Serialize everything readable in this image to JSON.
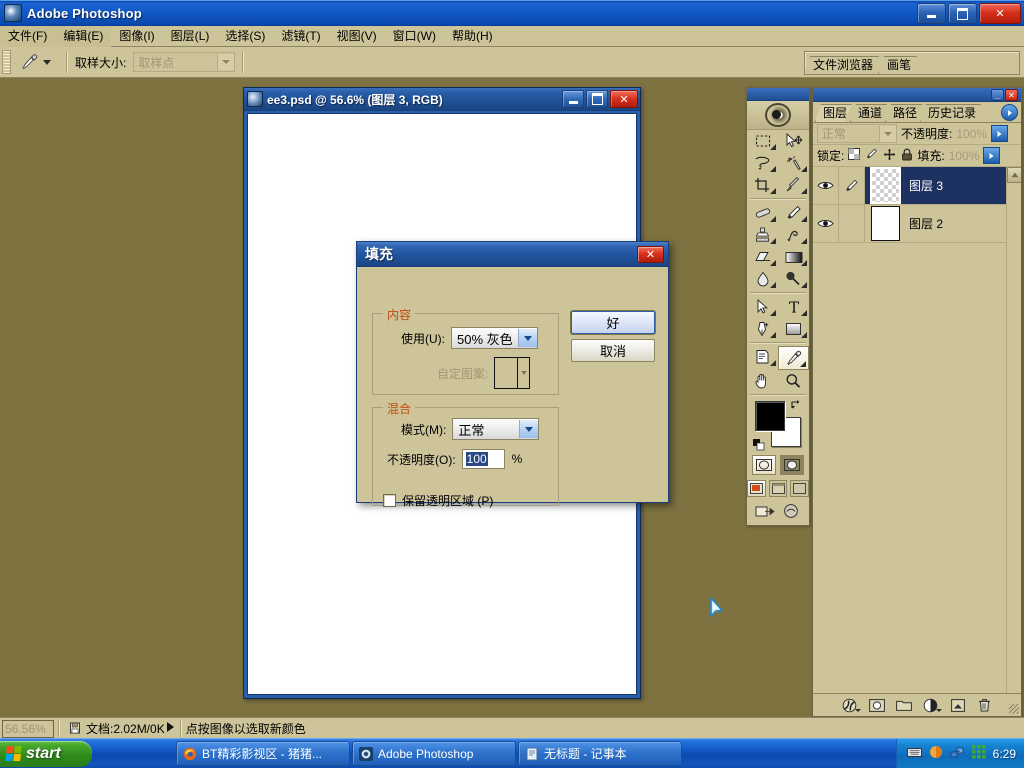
{
  "app": {
    "title": "Adobe Photoshop",
    "icon": "photoshop-icon",
    "window_buttons": {
      "minimize": "_",
      "maximize": "❐",
      "close": "✕"
    }
  },
  "menubar": {
    "items": [
      {
        "label": "文件(F)",
        "selected": true
      },
      {
        "label": "编辑(E)",
        "selected": true
      },
      {
        "label": "图像(I)",
        "selected": false
      },
      {
        "label": "图层(L)",
        "selected": false
      },
      {
        "label": "选择(S)",
        "selected": false
      },
      {
        "label": "滤镜(T)",
        "selected": false
      },
      {
        "label": "视图(V)",
        "selected": false
      },
      {
        "label": "窗口(W)",
        "selected": false
      },
      {
        "label": "帮助(H)",
        "selected": false
      }
    ]
  },
  "options_bar": {
    "active_tool_icon": "eyedropper-icon",
    "sample_size_label": "取样大小:",
    "sample_size_value": "取样点"
  },
  "palette_well": {
    "tabs": [
      {
        "label": "文件浏览器"
      },
      {
        "label": "画笔"
      }
    ]
  },
  "document_window": {
    "title": "ee3.psd @ 56.6% (图层 3, RGB)",
    "icon": "psd-document-icon",
    "buttons": {
      "minimize": "_",
      "maximize": "❐",
      "close": "✕"
    },
    "canvas_color": "#ffffff"
  },
  "toolbox": {
    "rows": [
      [
        {
          "name": "marquee-tool",
          "glyph": "marquee"
        },
        {
          "name": "move-tool",
          "glyph": "move"
        }
      ],
      [
        {
          "name": "lasso-tool",
          "glyph": "lasso"
        },
        {
          "name": "magic-wand-tool",
          "glyph": "wand"
        }
      ],
      [
        {
          "name": "crop-tool",
          "glyph": "crop"
        },
        {
          "name": "slice-tool",
          "glyph": "slice"
        }
      ],
      [
        {
          "name": "healing-brush-tool",
          "glyph": "healing"
        },
        {
          "name": "brush-tool",
          "glyph": "brush"
        }
      ],
      [
        {
          "name": "clone-stamp-tool",
          "glyph": "stamp"
        },
        {
          "name": "history-brush-tool",
          "glyph": "historybrush"
        }
      ],
      [
        {
          "name": "eraser-tool",
          "glyph": "eraser"
        },
        {
          "name": "gradient-tool",
          "glyph": "gradient"
        }
      ],
      [
        {
          "name": "blur-tool",
          "glyph": "blur"
        },
        {
          "name": "dodge-tool",
          "glyph": "dodge"
        }
      ],
      [
        {
          "name": "path-selection-tool",
          "glyph": "pathsel"
        },
        {
          "name": "type-tool",
          "glyph": "type"
        }
      ],
      [
        {
          "name": "pen-tool",
          "glyph": "pen"
        },
        {
          "name": "shape-tool",
          "glyph": "shape"
        }
      ],
      [
        {
          "name": "notes-tool",
          "glyph": "notes"
        },
        {
          "name": "eyedropper-tool",
          "glyph": "eyedropper",
          "active": true
        }
      ],
      [
        {
          "name": "hand-tool",
          "glyph": "hand"
        },
        {
          "name": "zoom-tool",
          "glyph": "zoom"
        }
      ]
    ],
    "foreground_color": "#000000",
    "background_color": "#ffffff"
  },
  "layers_palette": {
    "tabs": [
      {
        "label": "图层",
        "active": true
      },
      {
        "label": "通道",
        "active": false
      },
      {
        "label": "路径",
        "active": false
      },
      {
        "label": "历史记录",
        "active": false
      }
    ],
    "blend_mode": "正常",
    "opacity_label": "不透明度:",
    "opacity_value": "100%",
    "lock_label": "锁定:",
    "lock_icons": [
      "lock-transparency-icon",
      "lock-image-icon",
      "lock-position-icon",
      "lock-all-icon"
    ],
    "fill_label": "填充:",
    "fill_value": "100%",
    "layers": [
      {
        "name": "图层 3",
        "visible": true,
        "selected": true,
        "thumb": "transparent",
        "has_brush": true
      },
      {
        "name": "图层 2",
        "visible": true,
        "selected": false,
        "thumb": "white",
        "has_brush": false
      }
    ],
    "bottom_buttons": [
      "layer-style-icon",
      "layer-mask-icon",
      "new-group-icon",
      "adjustment-layer-icon",
      "new-layer-icon",
      "delete-layer-icon"
    ]
  },
  "fill_dialog": {
    "title": "填充",
    "close_label": "✕",
    "contents_group": {
      "legend": "内容",
      "use_label": "使用(U):",
      "use_value": "50% 灰色",
      "custom_pattern_label": "自定图案:",
      "custom_pattern_disabled": true
    },
    "blending_group": {
      "legend": "混合",
      "mode_label": "模式(M):",
      "mode_value": "正常",
      "opacity_label": "不透明度(O):",
      "opacity_value": "100",
      "opacity_unit": "%",
      "preserve_label": "保留透明区域 (P)",
      "preserve_checked": false
    },
    "ok_label": "好",
    "cancel_label": "取消"
  },
  "status_bar": {
    "zoom": "56.56%",
    "doc_icon": "document-size-icon",
    "doc_info": "文档:2.02M/0K",
    "play_icon": "play-arrow-icon",
    "hint": "点按图像以选取新颜色"
  },
  "taskbar": {
    "start_label": "start",
    "tasks": [
      {
        "label": "BT精彩影视区 - 猪猪...",
        "icon": "firefox-icon"
      },
      {
        "label": "Adobe Photoshop",
        "icon": "photoshop-icon"
      },
      {
        "label": "无标题 - 记事本",
        "icon": "notepad-icon"
      }
    ],
    "tray_icons": [
      "keyboard-layout-icon",
      "shield-icon",
      "network-icon",
      "grid-icon"
    ],
    "clock": "6:29"
  },
  "desktop": {
    "background_color": "#7d7240"
  },
  "cursor": {
    "type": "blue-arrow-pointer"
  }
}
